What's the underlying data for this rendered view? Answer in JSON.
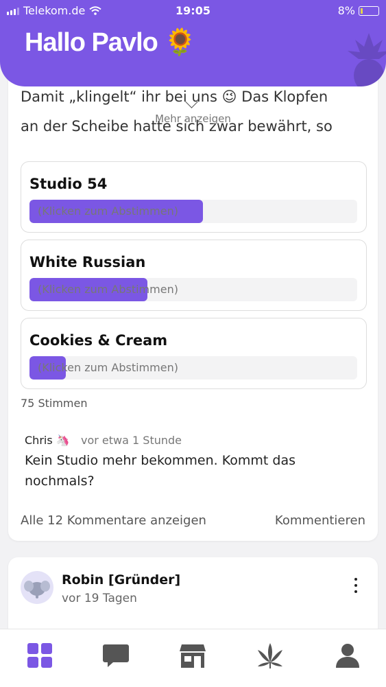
{
  "status_bar": {
    "carrier": "Telekom.de",
    "time": "19:05",
    "battery": "8%"
  },
  "header": {
    "greeting": "Hallo Pavlo 🌻"
  },
  "post": {
    "text_line1": "Damit „klingelt“ ihr bei uns 😉 Das Klopfen",
    "text_line2": "an der Scheibe hatte sich zwar bewährt, so",
    "show_more": "Mehr anzeigen",
    "poll_options": [
      {
        "title": "Studio 54",
        "hint": "(Klicken zum Abstimmen)",
        "share": 0.53
      },
      {
        "title": "White Russian",
        "hint": "(Klicken zum Abstimmen)",
        "share": 0.36
      },
      {
        "title": "Cookies & Cream",
        "hint": "(Klicken zum Abstimmen)",
        "share": 0.11
      }
    ],
    "votes": "75 Stimmen",
    "comment": {
      "author": "Chris 🦄",
      "time": "vor etwa 1 Stunde",
      "text": "Kein Studio mehr bekommen. Kommt das nochmals?"
    },
    "all_comments": "Alle 12 Kommentare anzeigen",
    "comment_button": "Kommentieren"
  },
  "post2": {
    "author": "Robin [Gründer]",
    "time": "vor 19 Tagen"
  },
  "nav": {
    "active_color": "#7b57e4",
    "inactive_color": "#555555",
    "items": [
      "dashboard-icon",
      "chat-icon",
      "shop-icon",
      "leaf-icon",
      "profile-icon"
    ]
  }
}
